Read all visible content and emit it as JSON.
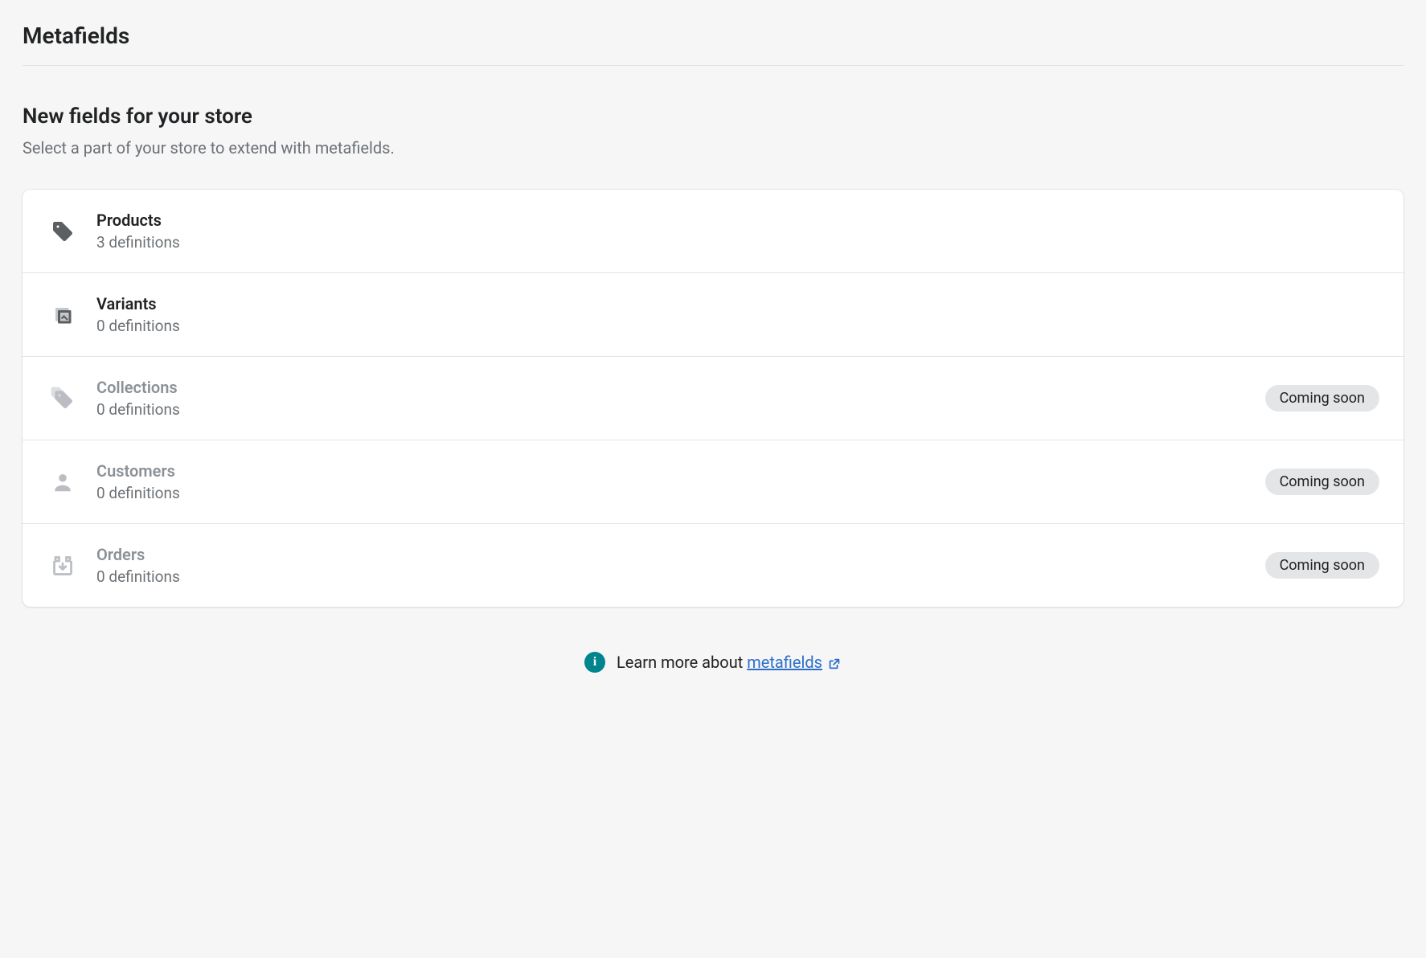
{
  "page_title": "Metafields",
  "section": {
    "heading": "New fields for your store",
    "subheading": "Select a part of your store to extend with metafields."
  },
  "rows": [
    {
      "title": "Products",
      "subtitle": "3 definitions",
      "coming_soon": false,
      "enabled": true
    },
    {
      "title": "Variants",
      "subtitle": "0 definitions",
      "coming_soon": false,
      "enabled": true
    },
    {
      "title": "Collections",
      "subtitle": "0 definitions",
      "coming_soon": true,
      "enabled": false
    },
    {
      "title": "Customers",
      "subtitle": "0 definitions",
      "coming_soon": true,
      "enabled": false
    },
    {
      "title": "Orders",
      "subtitle": "0 definitions",
      "coming_soon": true,
      "enabled": false
    }
  ],
  "badge_label": "Coming soon",
  "footer": {
    "text_prefix": "Learn more about ",
    "link_text": "metafields"
  }
}
